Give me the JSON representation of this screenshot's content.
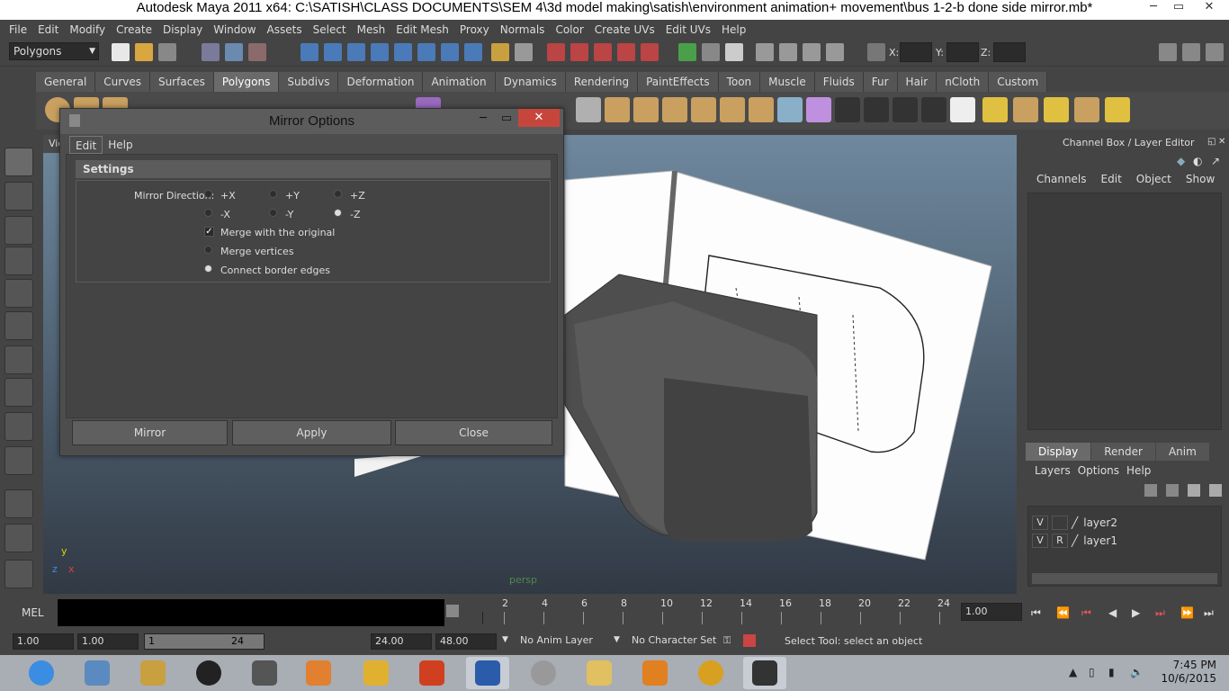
{
  "window": {
    "title": "Autodesk Maya 2011 x64: C:\\SATISH\\CLASS DOCUMENTS\\SEM 4\\3d model making\\satish\\environment animation+ movement\\bus 1-2-b done side mirror.mb*"
  },
  "menubar": [
    "File",
    "Edit",
    "Modify",
    "Create",
    "Display",
    "Window",
    "Assets",
    "Select",
    "Mesh",
    "Edit Mesh",
    "Proxy",
    "Normals",
    "Color",
    "Create UVs",
    "Edit UVs",
    "Help"
  ],
  "statusline": {
    "mode": "Polygons",
    "x_label": "X:",
    "y_label": "Y:",
    "z_label": "Z:"
  },
  "shelf_tabs": [
    "General",
    "Curves",
    "Surfaces",
    "Polygons",
    "Subdivs",
    "Deformation",
    "Animation",
    "Dynamics",
    "Rendering",
    "PaintEffects",
    "Toon",
    "Muscle",
    "Fluids",
    "Fur",
    "Hair",
    "nCloth",
    "Custom"
  ],
  "viewport": {
    "menu_fragment": "Vie",
    "camera": "persp",
    "axis_x": "x",
    "axis_y": "y",
    "axis_z": "z"
  },
  "channel_box": {
    "title": "Channel Box / Layer Editor",
    "menu": [
      "Channels",
      "Edit",
      "Object",
      "Show"
    ],
    "tabs": [
      "Display",
      "Render",
      "Anim"
    ],
    "layer_menu": [
      "Layers",
      "Options",
      "Help"
    ],
    "layers": [
      {
        "v": "V",
        "r": "",
        "name": "layer2"
      },
      {
        "v": "V",
        "r": "R",
        "name": "layer1"
      }
    ]
  },
  "timeline": {
    "mel": "MEL",
    "ticks": [
      "2",
      "4",
      "6",
      "8",
      "10",
      "12",
      "14",
      "16",
      "18",
      "20",
      "22",
      "24"
    ],
    "current": "1.00"
  },
  "range": {
    "start_time": "1.00",
    "playback_start": "1.00",
    "slider_start": "1",
    "slider_end": "24",
    "playback_end": "24.00",
    "end_time": "48.00",
    "anim_layer": "No Anim Layer",
    "character_set": "No Character Set",
    "help": "Select Tool: select an object"
  },
  "dialog": {
    "title": "Mirror Options",
    "menu": [
      "Edit",
      "Help"
    ],
    "section": "Settings",
    "mirror_direction_label": "Mirror Direction:",
    "directions": [
      "+X",
      "+Y",
      "+Z",
      "-X",
      "-Y",
      "-Z"
    ],
    "selected_direction": "-Z",
    "merge_original": "Merge with the original",
    "merge_vertices": "Merge vertices",
    "connect_border": "Connect border edges",
    "buttons": {
      "mirror": "Mirror",
      "apply": "Apply",
      "close": "Close"
    }
  },
  "taskbar": {
    "time": "7:45 PM",
    "date": "10/6/2015"
  }
}
